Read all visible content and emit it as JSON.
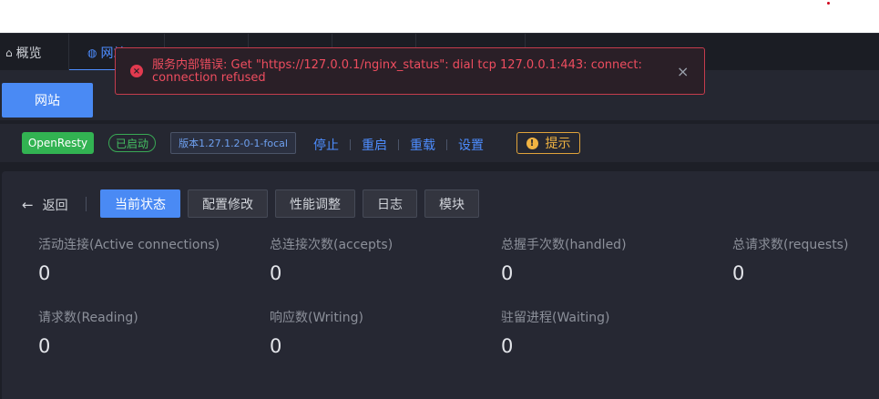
{
  "tabs": [
    {
      "icon": "home-icon",
      "glyph": "⌂",
      "label": "概览"
    },
    {
      "icon": "globe-icon",
      "glyph": "◍",
      "label": "网站"
    }
  ],
  "subbar": {
    "site_button": "网站"
  },
  "toolbar": {
    "openresty": "OpenResty",
    "status": "已启动",
    "version": "版本1.27.1.2-0-1-focal",
    "actions": [
      "停止",
      "重启",
      "重载",
      "设置"
    ],
    "hint": "提示"
  },
  "panel": {
    "back": "返回",
    "subtabs": [
      "当前状态",
      "配置修改",
      "性能调整",
      "日志",
      "模块"
    ],
    "stats": [
      {
        "label": "活动连接(Active connections)",
        "value": "0"
      },
      {
        "label": "总连接次数(accepts)",
        "value": "0"
      },
      {
        "label": "总握手次数(handled)",
        "value": "0"
      },
      {
        "label": "总请求数(requests)",
        "value": "0"
      },
      {
        "label": "请求数(Reading)",
        "value": "0"
      },
      {
        "label": "响应数(Writing)",
        "value": "0"
      },
      {
        "label": "驻留进程(Waiting)",
        "value": "0"
      }
    ]
  },
  "error": {
    "message": "服务内部错误: Get \"https://127.0.0.1/nginx_status\": dial tcp 127.0.0.1:443: connect: connection refused",
    "close": "×"
  },
  "colors": {
    "accent": "#4a8af4",
    "success": "#32b352",
    "warning": "#f0b342",
    "danger": "#e23a4f"
  }
}
